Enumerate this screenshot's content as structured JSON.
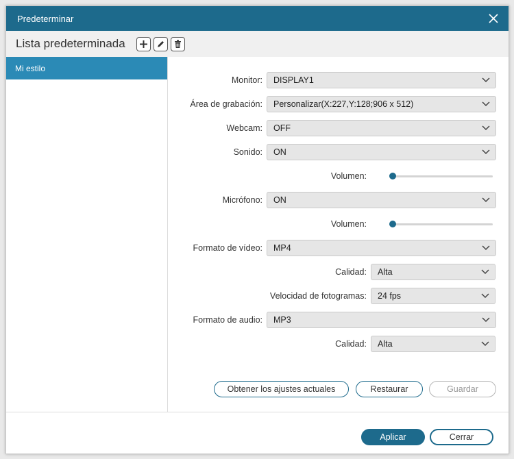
{
  "window": {
    "title": "Predeterminar"
  },
  "toolbar": {
    "list_title": "Lista predeterminada"
  },
  "sidebar": {
    "items": [
      {
        "label": "Mi estilo",
        "selected": true
      }
    ]
  },
  "form": {
    "monitor": {
      "label": "Monitor:",
      "value": "DISPLAY1"
    },
    "area": {
      "label": "Área de grabación:",
      "value": "Personalizar(X:227,Y:128;906 x 512)"
    },
    "webcam": {
      "label": "Webcam:",
      "value": "OFF"
    },
    "sound": {
      "label": "Sonido:",
      "value": "ON"
    },
    "sound_volume": {
      "label": "Volumen:",
      "level": 0
    },
    "microphone": {
      "label": "Micrófono:",
      "value": "ON"
    },
    "mic_volume": {
      "label": "Volumen:",
      "level": 0
    },
    "video_format": {
      "label": "Formato de vídeo:",
      "value": "MP4"
    },
    "video_quality": {
      "label": "Calidad:",
      "value": "Alta"
    },
    "frame_rate": {
      "label": "Velocidad de fotogramas:",
      "value": "24 fps"
    },
    "audio_format": {
      "label": "Formato de audio:",
      "value": "MP3"
    },
    "audio_quality": {
      "label": "Calidad:",
      "value": "Alta"
    }
  },
  "actions": {
    "get_current": "Obtener los ajustes actuales",
    "restore": "Restaurar",
    "save": "Guardar"
  },
  "footer": {
    "apply": "Aplicar",
    "close": "Cerrar"
  },
  "colors": {
    "accent": "#1d6a8c",
    "selected": "#2b8ab6"
  }
}
